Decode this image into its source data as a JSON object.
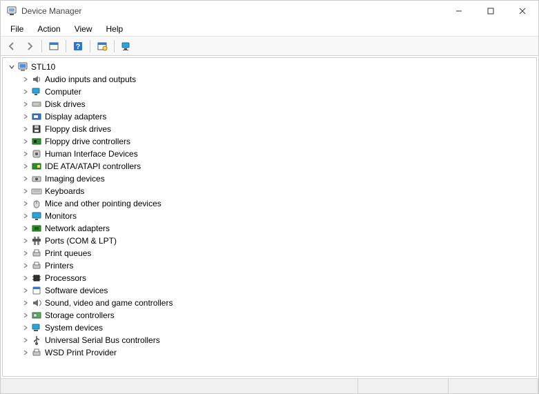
{
  "window": {
    "title": "Device Manager"
  },
  "menu": {
    "items": [
      "File",
      "Action",
      "View",
      "Help"
    ]
  },
  "toolbar": {
    "buttons": [
      {
        "name": "back-icon"
      },
      {
        "name": "forward-icon"
      },
      {
        "name": "sep"
      },
      {
        "name": "show-hidden-icon"
      },
      {
        "name": "sep"
      },
      {
        "name": "help-icon"
      },
      {
        "name": "sep"
      },
      {
        "name": "scan-hardware-icon"
      },
      {
        "name": "sep"
      },
      {
        "name": "devices-icon"
      }
    ]
  },
  "tree": {
    "root": {
      "label": "STL10",
      "expanded": true,
      "icon": "computer-root-icon"
    },
    "categories": [
      {
        "label": "Audio inputs and outputs",
        "icon": "audio-icon"
      },
      {
        "label": "Computer",
        "icon": "computer-icon"
      },
      {
        "label": "Disk drives",
        "icon": "disk-icon"
      },
      {
        "label": "Display adapters",
        "icon": "display-adapter-icon"
      },
      {
        "label": "Floppy disk drives",
        "icon": "floppy-icon"
      },
      {
        "label": "Floppy drive controllers",
        "icon": "floppy-controller-icon"
      },
      {
        "label": "Human Interface Devices",
        "icon": "hid-icon"
      },
      {
        "label": "IDE ATA/ATAPI controllers",
        "icon": "ide-icon"
      },
      {
        "label": "Imaging devices",
        "icon": "imaging-icon"
      },
      {
        "label": "Keyboards",
        "icon": "keyboard-icon"
      },
      {
        "label": "Mice and other pointing devices",
        "icon": "mouse-icon"
      },
      {
        "label": "Monitors",
        "icon": "monitor-icon"
      },
      {
        "label": "Network adapters",
        "icon": "network-icon"
      },
      {
        "label": "Ports (COM & LPT)",
        "icon": "ports-icon"
      },
      {
        "label": "Print queues",
        "icon": "print-queue-icon"
      },
      {
        "label": "Printers",
        "icon": "printer-icon"
      },
      {
        "label": "Processors",
        "icon": "processor-icon"
      },
      {
        "label": "Software devices",
        "icon": "software-icon"
      },
      {
        "label": "Sound, video and game controllers",
        "icon": "sound-icon"
      },
      {
        "label": "Storage controllers",
        "icon": "storage-icon"
      },
      {
        "label": "System devices",
        "icon": "system-icon"
      },
      {
        "label": "Universal Serial Bus controllers",
        "icon": "usb-icon"
      },
      {
        "label": "WSD Print Provider",
        "icon": "wsd-icon"
      }
    ]
  }
}
